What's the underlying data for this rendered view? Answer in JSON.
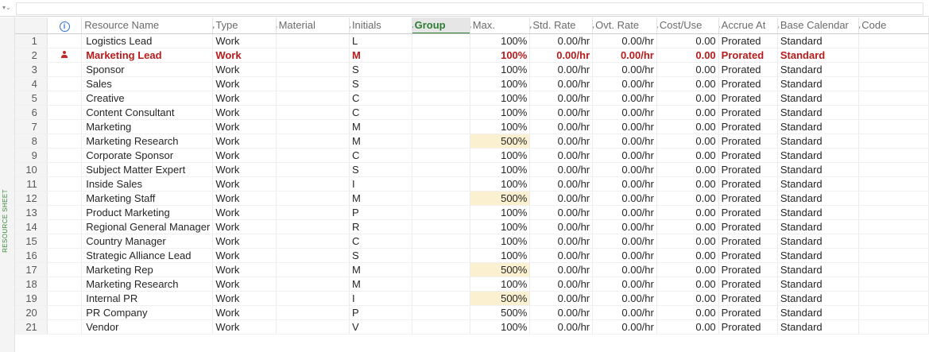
{
  "sidebar": {
    "label": "RESOURCE SHEET"
  },
  "columns": [
    {
      "key": "info",
      "label": "",
      "caret": false
    },
    {
      "key": "name",
      "label": "Resource Name",
      "caret": false
    },
    {
      "key": "type",
      "label": "Type",
      "caret": true
    },
    {
      "key": "material",
      "label": "Material",
      "caret": true
    },
    {
      "key": "initials",
      "label": "Initials",
      "caret": true
    },
    {
      "key": "group",
      "label": "Group",
      "caret": true
    },
    {
      "key": "max",
      "label": "Max.",
      "caret": true
    },
    {
      "key": "std_rate",
      "label": "Std. Rate",
      "caret": true
    },
    {
      "key": "ovt_rate",
      "label": "Ovt. Rate",
      "caret": true
    },
    {
      "key": "cost_use",
      "label": "Cost/Use",
      "caret": true
    },
    {
      "key": "accrue",
      "label": "Accrue At",
      "caret": true
    },
    {
      "key": "base_cal",
      "label": "Base Calendar",
      "caret": true
    },
    {
      "key": "code",
      "label": "Code",
      "caret": true
    }
  ],
  "rows": [
    {
      "n": "1",
      "name": "Logistics Lead",
      "type": "Work",
      "material": "",
      "initials": "L",
      "group": "",
      "max": "100%",
      "std": "0.00/hr",
      "ovt": "0.00/hr",
      "cost": "0.00",
      "accrue": "Prorated",
      "cal": "Standard",
      "code": ""
    },
    {
      "n": "2",
      "name": "Marketing Lead",
      "type": "Work",
      "material": "",
      "initials": "M",
      "group": "",
      "max": "100%",
      "std": "0.00/hr",
      "ovt": "0.00/hr",
      "cost": "0.00",
      "accrue": "Prorated",
      "cal": "Standard",
      "code": "",
      "selected": true,
      "indicator": "resource-overallocated-icon"
    },
    {
      "n": "3",
      "name": "Sponsor",
      "type": "Work",
      "material": "",
      "initials": "S",
      "group": "",
      "max": "100%",
      "std": "0.00/hr",
      "ovt": "0.00/hr",
      "cost": "0.00",
      "accrue": "Prorated",
      "cal": "Standard",
      "code": ""
    },
    {
      "n": "4",
      "name": "Sales",
      "type": "Work",
      "material": "",
      "initials": "S",
      "group": "",
      "max": "100%",
      "std": "0.00/hr",
      "ovt": "0.00/hr",
      "cost": "0.00",
      "accrue": "Prorated",
      "cal": "Standard",
      "code": ""
    },
    {
      "n": "5",
      "name": "Creative",
      "type": "Work",
      "material": "",
      "initials": "C",
      "group": "",
      "max": "100%",
      "std": "0.00/hr",
      "ovt": "0.00/hr",
      "cost": "0.00",
      "accrue": "Prorated",
      "cal": "Standard",
      "code": ""
    },
    {
      "n": "6",
      "name": "Content Consultant",
      "type": "Work",
      "material": "",
      "initials": "C",
      "group": "",
      "max": "100%",
      "std": "0.00/hr",
      "ovt": "0.00/hr",
      "cost": "0.00",
      "accrue": "Prorated",
      "cal": "Standard",
      "code": ""
    },
    {
      "n": "7",
      "name": "Marketing",
      "type": "Work",
      "material": "",
      "initials": "M",
      "group": "",
      "max": "100%",
      "std": "0.00/hr",
      "ovt": "0.00/hr",
      "cost": "0.00",
      "accrue": "Prorated",
      "cal": "Standard",
      "code": ""
    },
    {
      "n": "8",
      "name": "Marketing Research",
      "type": "Work",
      "material": "",
      "initials": "M",
      "group": "",
      "max": "500%",
      "std": "0.00/hr",
      "ovt": "0.00/hr",
      "cost": "0.00",
      "accrue": "Prorated",
      "cal": "Standard",
      "code": "",
      "hl": true
    },
    {
      "n": "9",
      "name": "Corporate Sponsor",
      "type": "Work",
      "material": "",
      "initials": "C",
      "group": "",
      "max": "100%",
      "std": "0.00/hr",
      "ovt": "0.00/hr",
      "cost": "0.00",
      "accrue": "Prorated",
      "cal": "Standard",
      "code": ""
    },
    {
      "n": "10",
      "name": "Subject Matter Expert",
      "type": "Work",
      "material": "",
      "initials": "S",
      "group": "",
      "max": "100%",
      "std": "0.00/hr",
      "ovt": "0.00/hr",
      "cost": "0.00",
      "accrue": "Prorated",
      "cal": "Standard",
      "code": ""
    },
    {
      "n": "11",
      "name": "Inside Sales",
      "type": "Work",
      "material": "",
      "initials": "I",
      "group": "",
      "max": "100%",
      "std": "0.00/hr",
      "ovt": "0.00/hr",
      "cost": "0.00",
      "accrue": "Prorated",
      "cal": "Standard",
      "code": ""
    },
    {
      "n": "12",
      "name": "Marketing Staff",
      "type": "Work",
      "material": "",
      "initials": "M",
      "group": "",
      "max": "500%",
      "std": "0.00/hr",
      "ovt": "0.00/hr",
      "cost": "0.00",
      "accrue": "Prorated",
      "cal": "Standard",
      "code": "",
      "hl": true
    },
    {
      "n": "13",
      "name": "Product Marketing",
      "type": "Work",
      "material": "",
      "initials": "P",
      "group": "",
      "max": "100%",
      "std": "0.00/hr",
      "ovt": "0.00/hr",
      "cost": "0.00",
      "accrue": "Prorated",
      "cal": "Standard",
      "code": ""
    },
    {
      "n": "14",
      "name": "Regional General Manager",
      "type": "Work",
      "material": "",
      "initials": "R",
      "group": "",
      "max": "100%",
      "std": "0.00/hr",
      "ovt": "0.00/hr",
      "cost": "0.00",
      "accrue": "Prorated",
      "cal": "Standard",
      "code": ""
    },
    {
      "n": "15",
      "name": "Country Manager",
      "type": "Work",
      "material": "",
      "initials": "C",
      "group": "",
      "max": "100%",
      "std": "0.00/hr",
      "ovt": "0.00/hr",
      "cost": "0.00",
      "accrue": "Prorated",
      "cal": "Standard",
      "code": ""
    },
    {
      "n": "16",
      "name": "Strategic Alliance Lead",
      "type": "Work",
      "material": "",
      "initials": "S",
      "group": "",
      "max": "100%",
      "std": "0.00/hr",
      "ovt": "0.00/hr",
      "cost": "0.00",
      "accrue": "Prorated",
      "cal": "Standard",
      "code": ""
    },
    {
      "n": "17",
      "name": "Marketing Rep",
      "type": "Work",
      "material": "",
      "initials": "M",
      "group": "",
      "max": "500%",
      "std": "0.00/hr",
      "ovt": "0.00/hr",
      "cost": "0.00",
      "accrue": "Prorated",
      "cal": "Standard",
      "code": "",
      "hl": true
    },
    {
      "n": "18",
      "name": "Marketing Research",
      "type": "Work",
      "material": "",
      "initials": "M",
      "group": "",
      "max": "100%",
      "std": "0.00/hr",
      "ovt": "0.00/hr",
      "cost": "0.00",
      "accrue": "Prorated",
      "cal": "Standard",
      "code": ""
    },
    {
      "n": "19",
      "name": "Internal PR",
      "type": "Work",
      "material": "",
      "initials": "I",
      "group": "",
      "max": "500%",
      "std": "0.00/hr",
      "ovt": "0.00/hr",
      "cost": "0.00",
      "accrue": "Prorated",
      "cal": "Standard",
      "code": "",
      "hl": true
    },
    {
      "n": "20",
      "name": "PR Company",
      "type": "Work",
      "material": "",
      "initials": "P",
      "group": "",
      "max": "500%",
      "std": "0.00/hr",
      "ovt": "0.00/hr",
      "cost": "0.00",
      "accrue": "Prorated",
      "cal": "Standard",
      "code": ""
    },
    {
      "n": "21",
      "name": "Vendor",
      "type": "Work",
      "material": "",
      "initials": "V",
      "group": "",
      "max": "100%",
      "std": "0.00/hr",
      "ovt": "0.00/hr",
      "cost": "0.00",
      "accrue": "Prorated",
      "cal": "Standard",
      "code": ""
    }
  ],
  "colors": {
    "selected_text": "#b71c1c",
    "group_header": "#2e7d32",
    "highlight_cell": "#fbf1d0",
    "sidebar_text": "#3a8a3a"
  }
}
